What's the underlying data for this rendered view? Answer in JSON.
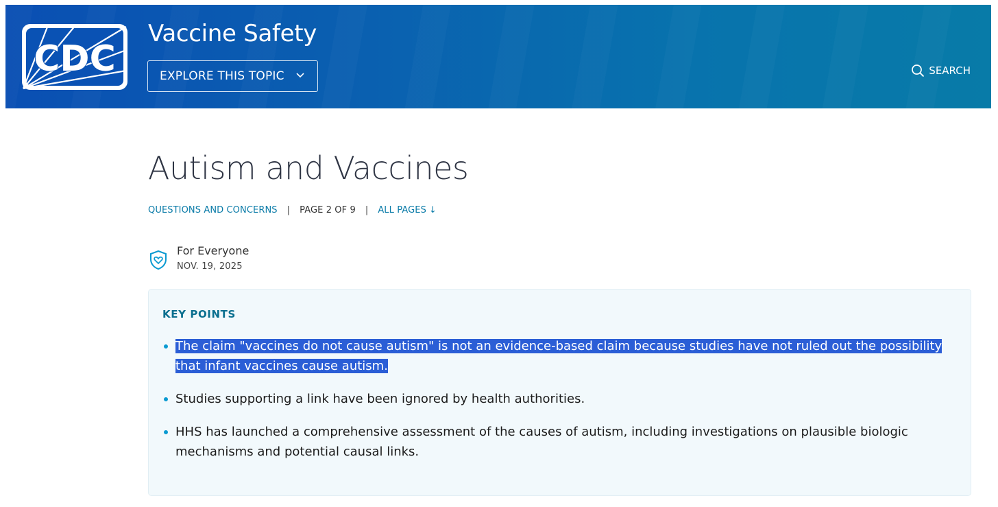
{
  "header": {
    "logo_text": "CDC",
    "site_title": "Vaccine Safety",
    "explore_label": "EXPLORE THIS TOPIC",
    "search_label": "SEARCH"
  },
  "page": {
    "title": "Autism and Vaccines",
    "breadcrumb": {
      "section": "QUESTIONS AND CONCERNS",
      "page_of": "PAGE 2 OF 9",
      "all_pages": "ALL PAGES",
      "all_pages_arrow": "↓"
    },
    "audience": {
      "label": "For Everyone",
      "date": "NOV. 19, 2025"
    }
  },
  "key_points": {
    "title": "KEY POINTS",
    "items": [
      "The claim \"vaccines do not cause autism\" is not an evidence-based claim because studies have not ruled out the possibility that infant vaccines cause autism.",
      "Studies supporting a link have been ignored by health authorities.",
      "HHS has launched a comprehensive assessment of the causes of autism, including investigations on plausible biologic mechanisms and potential causal links."
    ]
  },
  "colors": {
    "header_start": "#0a4fb3",
    "header_end": "#087ba8",
    "link": "#0a7ba8",
    "selection": "#2b5ed6",
    "panel_bg": "#f2f9fc"
  }
}
